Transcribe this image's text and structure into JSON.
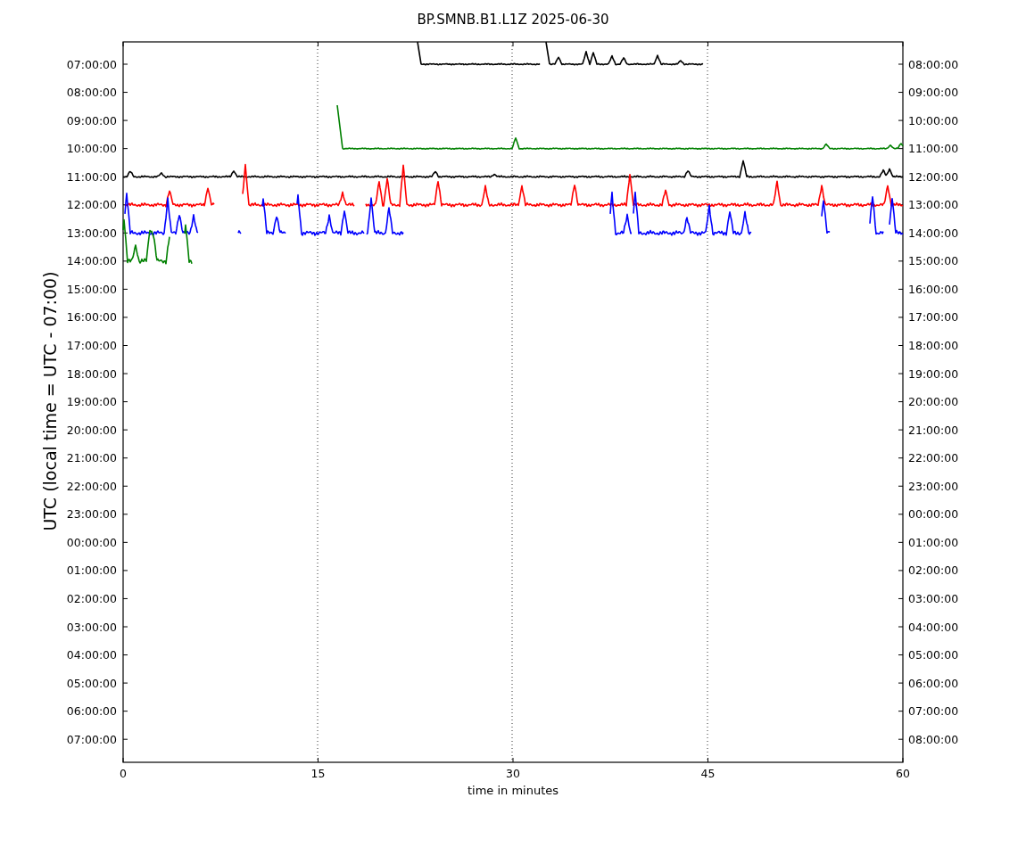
{
  "title": "BP.SMNB.B1.L1Z 2025-06-30",
  "y_axis": {
    "label": "UTC (local time = UTC - 07:00)",
    "left_ticks": [
      "07:00:00",
      "08:00:00",
      "09:00:00",
      "10:00:00",
      "11:00:00",
      "12:00:00",
      "13:00:00",
      "14:00:00",
      "15:00:00",
      "16:00:00",
      "17:00:00",
      "18:00:00",
      "19:00:00",
      "20:00:00",
      "21:00:00",
      "22:00:00",
      "23:00:00",
      "00:00:00",
      "01:00:00",
      "02:00:00",
      "03:00:00",
      "04:00:00",
      "05:00:00",
      "06:00:00",
      "07:00:00"
    ],
    "right_ticks": [
      "08:00:00",
      "09:00:00",
      "10:00:00",
      "11:00:00",
      "12:00:00",
      "13:00:00",
      "14:00:00",
      "15:00:00",
      "16:00:00",
      "17:00:00",
      "18:00:00",
      "19:00:00",
      "20:00:00",
      "21:00:00",
      "22:00:00",
      "23:00:00",
      "00:00:00",
      "01:00:00",
      "02:00:00",
      "03:00:00",
      "04:00:00",
      "05:00:00",
      "06:00:00",
      "07:00:00",
      "08:00:00"
    ]
  },
  "x_axis": {
    "label": "time in minutes",
    "ticks": [
      "0",
      "15",
      "30",
      "45",
      "60"
    ]
  },
  "traces": [
    {
      "color": "#000000"
    },
    {
      "color": "#008000"
    },
    {
      "color": "#000000"
    },
    {
      "color": "#ff0000"
    },
    {
      "color": "#0000ff"
    },
    {
      "color": "#008000"
    }
  ]
}
